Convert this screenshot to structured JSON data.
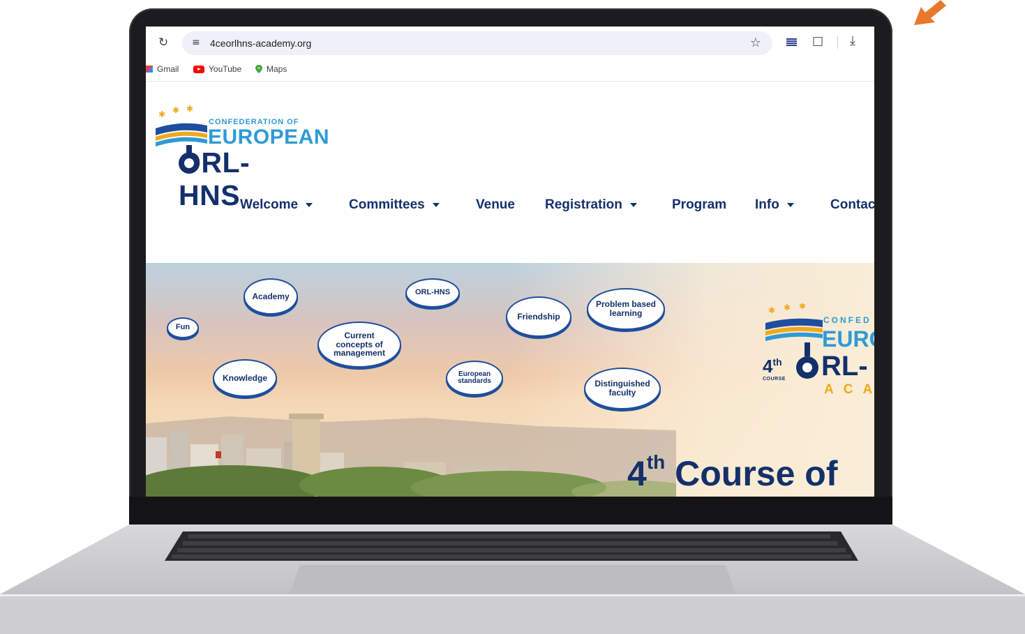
{
  "browser": {
    "url": "4ceorlhns-academy.org",
    "bookmarks": [
      "Gmail",
      "YouTube",
      "Maps"
    ],
    "icons": [
      "reload-icon",
      "site-settings-icon",
      "bookmark-star-icon",
      "extension-flag-icon",
      "puzzle-extensions-icon",
      "download-icon"
    ]
  },
  "site": {
    "logo": {
      "line1": "CONFEDERATION OF",
      "line2": "EUROPEAN",
      "line3": "ORL-HNS"
    },
    "nav": [
      {
        "label": "Welcome",
        "dropdown": true
      },
      {
        "label": "Committees",
        "dropdown": true
      },
      {
        "label": "Venue",
        "dropdown": false
      },
      {
        "label": "Registration",
        "dropdown": true
      },
      {
        "label": "Program",
        "dropdown": false
      },
      {
        "label": "Info",
        "dropdown": true
      },
      {
        "label": "Contac",
        "dropdown": false
      }
    ],
    "hero": {
      "clouds": [
        "Academy",
        "ORL-HNS",
        "Friendship",
        "Problem based learning",
        "Fun",
        "Current concepts of management",
        "Knowledge",
        "European standards",
        "Distinguished faculty"
      ],
      "logo": {
        "conf": "CONFED",
        "euro": "EURO",
        "orl": "RL-",
        "academy": "ACA",
        "course_num": "4",
        "course_sup": "th",
        "course_label": "COURSE"
      },
      "title_num": "4",
      "title_sup": "th",
      "title_rest": " Course of"
    }
  },
  "colors": {
    "navy": "#14306b",
    "sky_blue": "#2f9ad7",
    "gold": "#f0a81c",
    "accent_orange": "#e8782a"
  }
}
